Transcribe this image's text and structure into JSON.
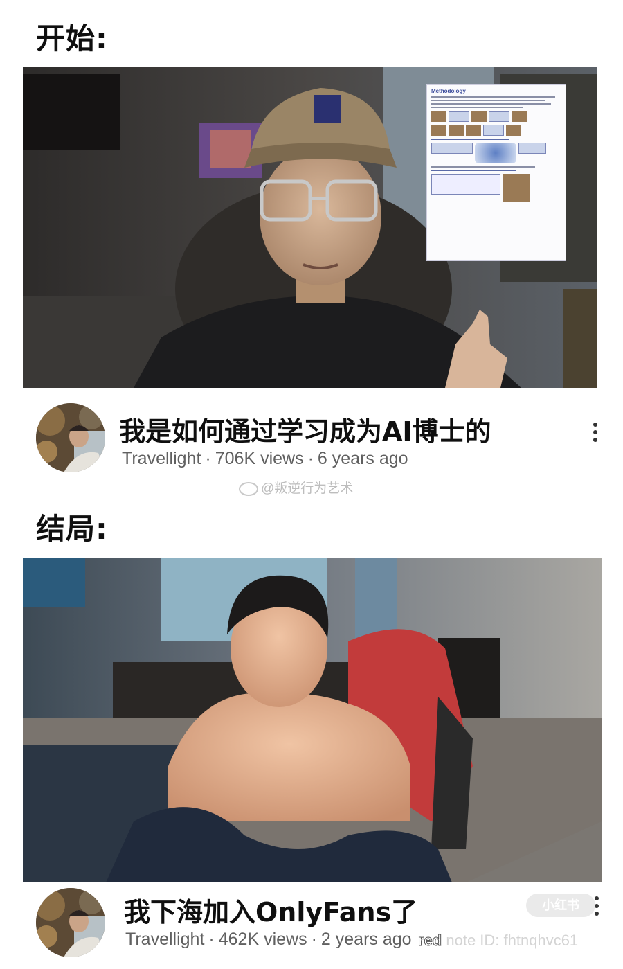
{
  "labels": {
    "start": "开始:",
    "end": "结局:"
  },
  "videos": [
    {
      "title": "我是如何通过学习成为AI博士的",
      "channel": "Travellight",
      "views": "706K views",
      "age": "6 years ago",
      "slide_title": "Methodology"
    },
    {
      "title": "我下海加入OnlyFans了",
      "channel": "Travellight",
      "views": "462K views",
      "age": "2 years ago"
    }
  ],
  "meta_separator": "·",
  "watermark": "@叛逆行为艺术",
  "rednote": {
    "badge": "小红书",
    "brand": "red",
    "note_id": "note ID: fhtnqhvc61"
  },
  "icons": {
    "more": "more-vert-icon",
    "weibo": "weibo-icon"
  }
}
